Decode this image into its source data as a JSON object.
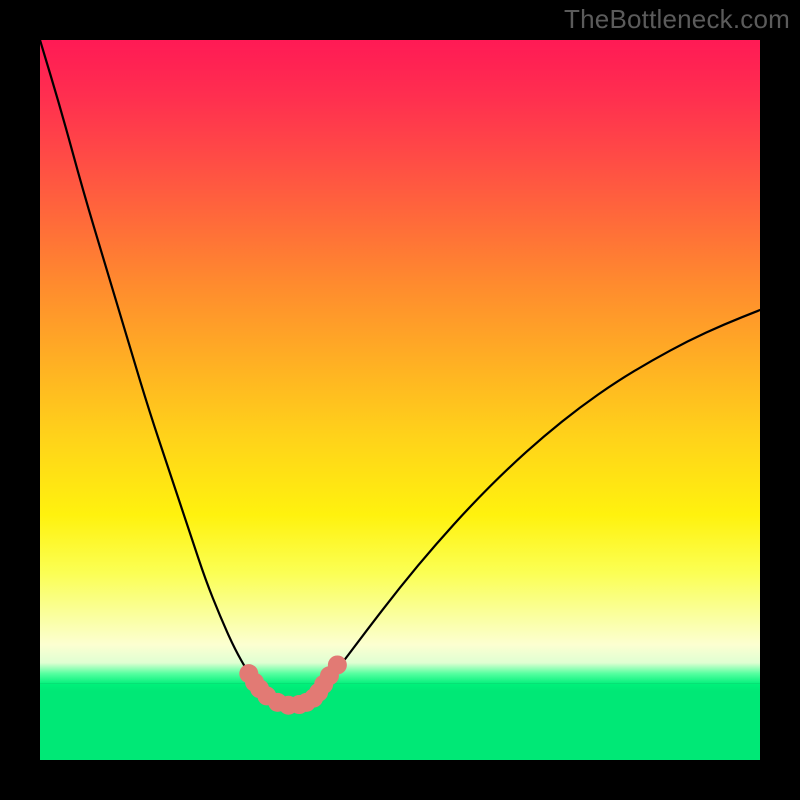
{
  "watermark": "TheBottleneck.com",
  "chart_data": {
    "type": "line",
    "title": "",
    "xlabel": "",
    "ylabel": "",
    "xlim": [
      0,
      100
    ],
    "ylim": [
      0,
      100
    ],
    "grid": false,
    "x": [
      0,
      3,
      6,
      9,
      12,
      15,
      18,
      21,
      23,
      25,
      27,
      29,
      30,
      31,
      32,
      33,
      34,
      35,
      36,
      37,
      38.5,
      40,
      42,
      45,
      50,
      55,
      60,
      65,
      70,
      75,
      80,
      85,
      90,
      95,
      100
    ],
    "series": [
      {
        "name": "bottleneck-curve",
        "values": [
          100,
          90,
          79,
          69,
          59,
          49,
          40,
          31,
          25,
          20,
          15.5,
          12,
          10.5,
          9.3,
          8.4,
          7.8,
          7.5,
          7.5,
          7.7,
          8.2,
          9.3,
          11,
          13.5,
          17.5,
          24,
          30,
          35.5,
          40.5,
          45,
          49,
          52.5,
          55.5,
          58.2,
          60.5,
          62.5
        ]
      }
    ],
    "markers": {
      "name": "highlight-dots",
      "color": "#e27a74",
      "points": [
        {
          "x": 29.0,
          "y": 12.0
        },
        {
          "x": 29.8,
          "y": 10.8
        },
        {
          "x": 30.5,
          "y": 9.9
        },
        {
          "x": 31.5,
          "y": 8.9
        },
        {
          "x": 33.0,
          "y": 8.0
        },
        {
          "x": 34.5,
          "y": 7.6
        },
        {
          "x": 36.0,
          "y": 7.7
        },
        {
          "x": 37.0,
          "y": 8.0
        },
        {
          "x": 38.0,
          "y": 8.6
        },
        {
          "x": 38.7,
          "y": 9.4
        },
        {
          "x": 39.4,
          "y": 10.5
        },
        {
          "x": 40.2,
          "y": 11.7
        },
        {
          "x": 41.3,
          "y": 13.2
        }
      ]
    },
    "gradient_stops": [
      {
        "pos": 0.0,
        "color": "#ff1a55"
      },
      {
        "pos": 0.08,
        "color": "#ff2f4f"
      },
      {
        "pos": 0.16,
        "color": "#ff4a46"
      },
      {
        "pos": 0.25,
        "color": "#ff6a3a"
      },
      {
        "pos": 0.34,
        "color": "#ff8b2e"
      },
      {
        "pos": 0.44,
        "color": "#ffad24"
      },
      {
        "pos": 0.55,
        "color": "#ffd21a"
      },
      {
        "pos": 0.66,
        "color": "#fff20e"
      },
      {
        "pos": 0.74,
        "color": "#fbff54"
      },
      {
        "pos": 0.8,
        "color": "#faff9f"
      },
      {
        "pos": 0.84,
        "color": "#fcffd1"
      },
      {
        "pos": 0.865,
        "color": "#e0ffd2"
      },
      {
        "pos": 0.88,
        "color": "#55ffa0"
      },
      {
        "pos": 0.895,
        "color": "#00f07a"
      },
      {
        "pos": 0.905,
        "color": "#00e876"
      }
    ]
  }
}
